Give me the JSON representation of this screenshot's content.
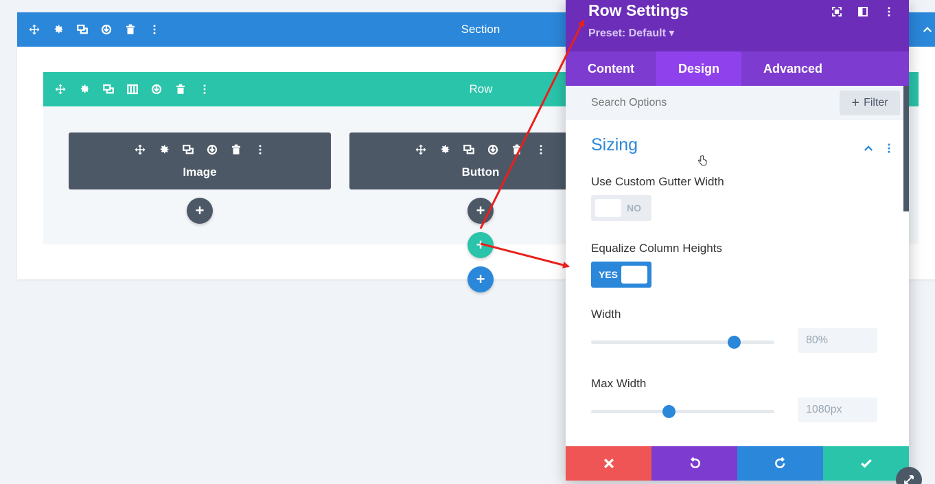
{
  "section": {
    "title": "Section"
  },
  "row": {
    "title": "Row"
  },
  "modules": [
    {
      "label": "Image"
    },
    {
      "label": "Button"
    }
  ],
  "add_symbol": "+",
  "panel": {
    "title": "Row Settings",
    "preset": "Preset: Default ▾",
    "tabs": [
      {
        "label": "Content",
        "active": false
      },
      {
        "label": "Design",
        "active": true
      },
      {
        "label": "Advanced",
        "active": false
      }
    ],
    "search": {
      "placeholder": "Search Options"
    },
    "filter_label": "Filter",
    "group_title": "Sizing",
    "fields": {
      "gutter": {
        "label": "Use Custom Gutter Width",
        "state": "NO"
      },
      "equalize": {
        "label": "Equalize Column Heights",
        "state": "YES"
      },
      "width": {
        "label": "Width",
        "value": "80%"
      },
      "max_width": {
        "label": "Max Width",
        "value": "1080px"
      }
    }
  },
  "colors": {
    "section_blue": "#2b87da",
    "row_teal": "#29c4a9",
    "module_gray": "#4c5866",
    "panel_purple": "#6c2eb9",
    "tab_purple": "#7e3bd0",
    "tab_active": "#8f42ec",
    "cancel_red": "#ef5555",
    "undo_purple": "#7e3bd0",
    "redo_blue": "#2b87da",
    "save_teal": "#29c4a9",
    "annotation_red": "#e8201c"
  }
}
